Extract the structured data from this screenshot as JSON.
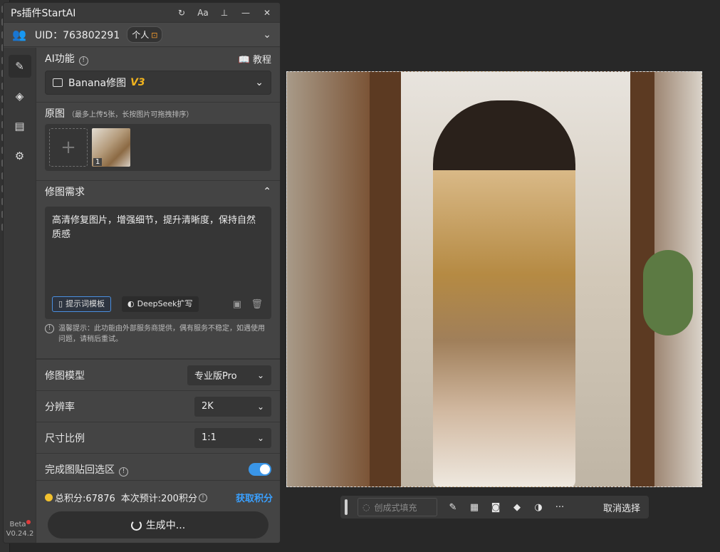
{
  "window": {
    "title": "Ps插件StartAI",
    "actions": [
      "refresh-icon",
      "font-size-icon",
      "pin-icon",
      "minimize-icon",
      "close-icon"
    ]
  },
  "user": {
    "uid_label": "UID：763802291",
    "badge": "个人",
    "badge_icon": "lock-icon"
  },
  "sidebar": {
    "items": [
      "edit-icon",
      "layers-icon",
      "clipboard-icon",
      "gear-icon"
    ],
    "beta_label": "Beta",
    "version": "V0.24.2"
  },
  "ai": {
    "section_label": "AI功能",
    "tutorial_label": "教程",
    "feature_select": "Banana修图",
    "feature_version": "V3"
  },
  "original": {
    "label": "原图",
    "hint": "（最多上传5张，长按图片可拖拽排序）",
    "thumb_index": "1"
  },
  "prompt": {
    "section_label": "修图需求",
    "text": "高清修复图片，增强细节，提升清晰度，保持自然质感",
    "template_button": "提示词模板",
    "deepseek_button": "DeepSeek扩写"
  },
  "notice": "温馨提示：此功能由外部服务商提供，偶有服务不稳定，如遇使用问题，请稍后重试。",
  "options": {
    "model_label": "修图模型",
    "model_value": "专业版Pro",
    "resolution_label": "分辨率",
    "resolution_value": "2K",
    "ratio_label": "尺寸比例",
    "ratio_value": "1:1",
    "paste_back_label": "完成图贴回选区",
    "paste_back_on": true
  },
  "footer": {
    "total_credits": "总积分:67876",
    "estimate": "本次预计:200积分",
    "get_credits": "获取积分",
    "generate_label": "生成中..."
  },
  "contextbar": {
    "generative_fill": "创成式填充",
    "cancel_selection": "取消选择"
  },
  "colors": {
    "accent_blue": "#3aa0ff",
    "toggle_blue": "#3a96e8",
    "version_gold": "#f2b41e",
    "coin": "#f2c12e"
  }
}
